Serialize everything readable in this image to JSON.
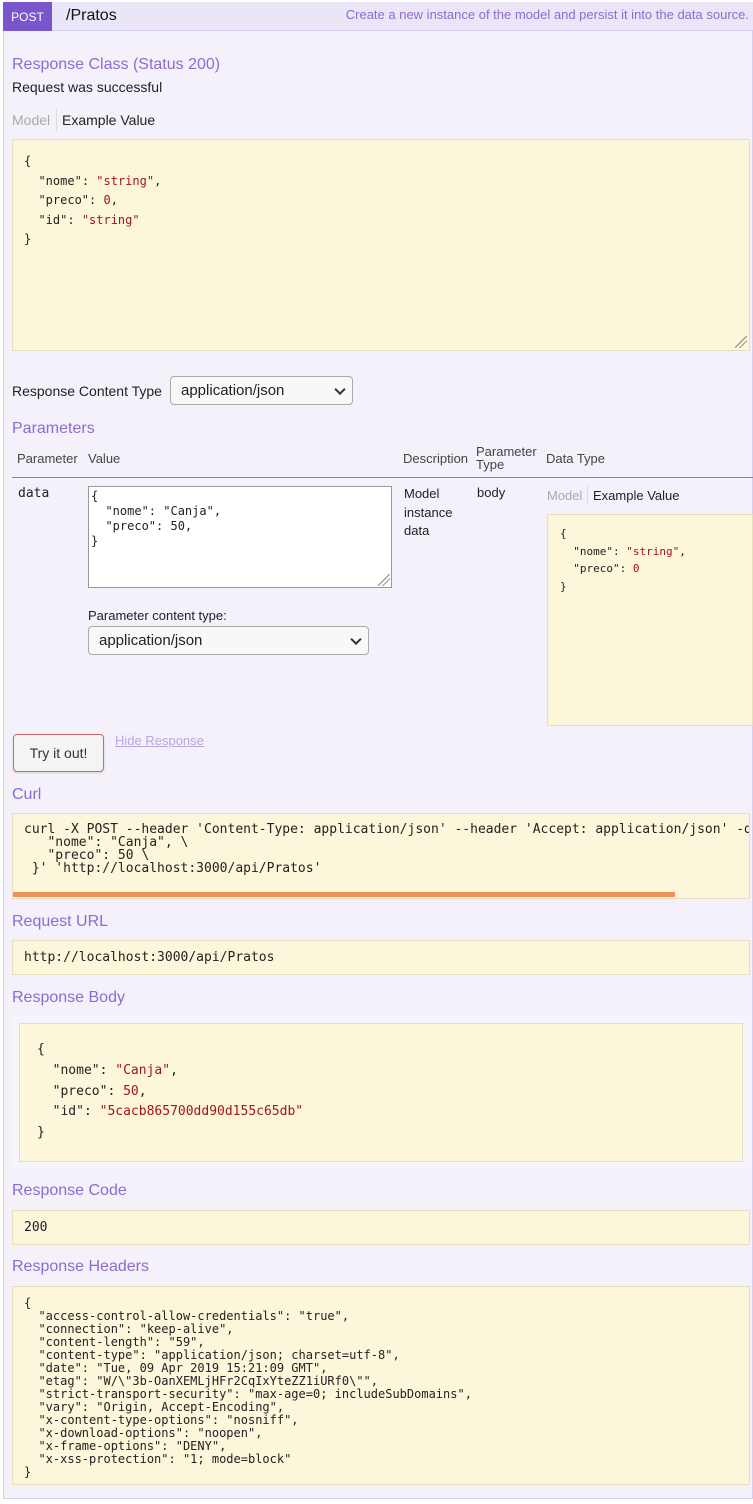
{
  "operation": {
    "verb": "POST",
    "path": "/Pratos",
    "summary": "Create a new instance of the model and persist it into the data source."
  },
  "response_class": {
    "title": "Response Class (Status 200)",
    "description": "Request was successful",
    "tab_model": "Model",
    "tab_example": "Example Value",
    "example_lines": [
      "{",
      "  \"nome\": \"string\",",
      "  \"preco\": 0,",
      "  \"id\": \"string\"",
      "}"
    ]
  },
  "response_content_type": {
    "label": "Response Content Type",
    "selected": "application/json"
  },
  "parameters": {
    "title": "Parameters",
    "headers": {
      "parameter": "Parameter",
      "value": "Value",
      "description": "Description",
      "parameter_type_1": "Parameter",
      "parameter_type_2": "Type",
      "data_type": "Data Type"
    },
    "row": {
      "name": "data",
      "value_lines": [
        "{",
        "  \"nome\": \"Canja\",",
        "  \"preco\": 50,",
        "}"
      ],
      "description_lines": [
        "Model",
        "instance",
        "data"
      ],
      "param_type": "body",
      "content_type_label": "Parameter content type:",
      "content_type_selected": "application/json",
      "dt_tab_model": "Model",
      "dt_tab_example": "Example Value",
      "dt_example_lines": [
        "{",
        "  \"nome\": \"string\",",
        "  \"preco\": 0",
        "}"
      ]
    }
  },
  "actions": {
    "try_label": "Try it out!",
    "hide_label": "Hide Response"
  },
  "curl": {
    "title": "Curl",
    "lines": [
      "curl -X POST --header 'Content-Type: application/json' --header 'Accept: application/json' -d '{ \\",
      "   \"nome\": \"Canja\", \\",
      "   \"preco\": 50 \\",
      " }' 'http://localhost:3000/api/Pratos'"
    ]
  },
  "request_url": {
    "title": "Request URL",
    "value": "http://localhost:3000/api/Pratos"
  },
  "response_body": {
    "title": "Response Body",
    "lines": [
      "{",
      "  \"nome\": \"Canja\",",
      "  \"preco\": 50,",
      "  \"id\": \"5cacb865700dd90d155c65db\"",
      "}"
    ]
  },
  "response_code": {
    "title": "Response Code",
    "value": "200"
  },
  "response_headers": {
    "title": "Response Headers",
    "lines": [
      "{",
      "  \"access-control-allow-credentials\": \"true\",",
      "  \"connection\": \"keep-alive\",",
      "  \"content-length\": \"59\",",
      "  \"content-type\": \"application/json; charset=utf-8\",",
      "  \"date\": \"Tue, 09 Apr 2019 15:21:09 GMT\",",
      "  \"etag\": \"W/\\\"3b-OanXEMLjHFr2CqIxYteZZ1iURf0\\\"\",",
      "  \"strict-transport-security\": \"max-age=0; includeSubDomains\",",
      "  \"vary\": \"Origin, Accept-Encoding\",",
      "  \"x-content-type-options\": \"nosniff\",",
      "  \"x-download-options\": \"noopen\",",
      "  \"x-frame-options\": \"DENY\",",
      "  \"x-xss-protection\": \"1; mode=block\"",
      "}"
    ]
  },
  "colors": {
    "accent": "#7a56cc",
    "section_title": "#8c6cd2",
    "code_bg": "#fcf6db",
    "scroll_thumb": "#f0905e"
  }
}
